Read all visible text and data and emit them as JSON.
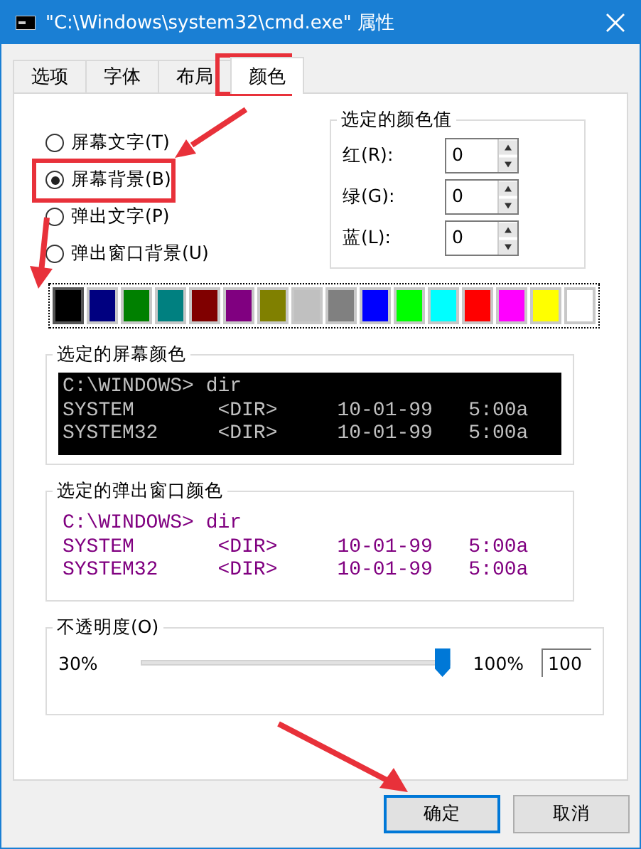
{
  "window": {
    "title": "\"C:\\Windows\\system32\\cmd.exe\" 属性"
  },
  "tabs": [
    {
      "label": "选项",
      "selected": false
    },
    {
      "label": "字体",
      "selected": false
    },
    {
      "label": "布局",
      "selected": false
    },
    {
      "label": "颜色",
      "selected": true
    }
  ],
  "radios": [
    {
      "label": "屏幕文字(T)",
      "selected": false
    },
    {
      "label": "屏幕背景(B)",
      "selected": true
    },
    {
      "label": "弹出文字(P)",
      "selected": false
    },
    {
      "label": "弹出窗口背景(U)",
      "selected": false
    }
  ],
  "color_values": {
    "title": "选定的颜色值",
    "fields": [
      {
        "label": "红(R):",
        "value": "0"
      },
      {
        "label": "绿(G):",
        "value": "0"
      },
      {
        "label": "蓝(L):",
        "value": "0"
      }
    ]
  },
  "palette": [
    {
      "color": "#000000",
      "selected": true
    },
    {
      "color": "#000080",
      "selected": false
    },
    {
      "color": "#008000",
      "selected": false
    },
    {
      "color": "#008080",
      "selected": false
    },
    {
      "color": "#800000",
      "selected": false
    },
    {
      "color": "#800080",
      "selected": false
    },
    {
      "color": "#808000",
      "selected": false
    },
    {
      "color": "#c0c0c0",
      "selected": false
    },
    {
      "color": "#808080",
      "selected": false
    },
    {
      "color": "#0000ff",
      "selected": false
    },
    {
      "color": "#00ff00",
      "selected": false
    },
    {
      "color": "#00ffff",
      "selected": false
    },
    {
      "color": "#ff0000",
      "selected": false
    },
    {
      "color": "#ff00ff",
      "selected": false
    },
    {
      "color": "#ffff00",
      "selected": false
    },
    {
      "color": "#ffffff",
      "selected": false
    }
  ],
  "previews": [
    {
      "kind": "screen",
      "title": "选定的屏幕颜色",
      "lines": [
        "C:\\WINDOWS> dir",
        "SYSTEM       <DIR>     10-01-99   5:00a",
        "SYSTEM32     <DIR>     10-01-99   5:00a"
      ]
    },
    {
      "kind": "popup",
      "title": "选定的弹出窗口颜色",
      "lines": [
        "C:\\WINDOWS> dir",
        "SYSTEM       <DIR>     10-01-99   5:00a",
        "SYSTEM32     <DIR>     10-01-99   5:00a"
      ]
    }
  ],
  "opacity": {
    "title": "不透明度(O)",
    "min_label": "30%",
    "max_label": "100%",
    "level": 1,
    "value": "100"
  },
  "buttons": [
    {
      "label": "确定",
      "default": true
    },
    {
      "label": "取消",
      "default": false
    }
  ]
}
